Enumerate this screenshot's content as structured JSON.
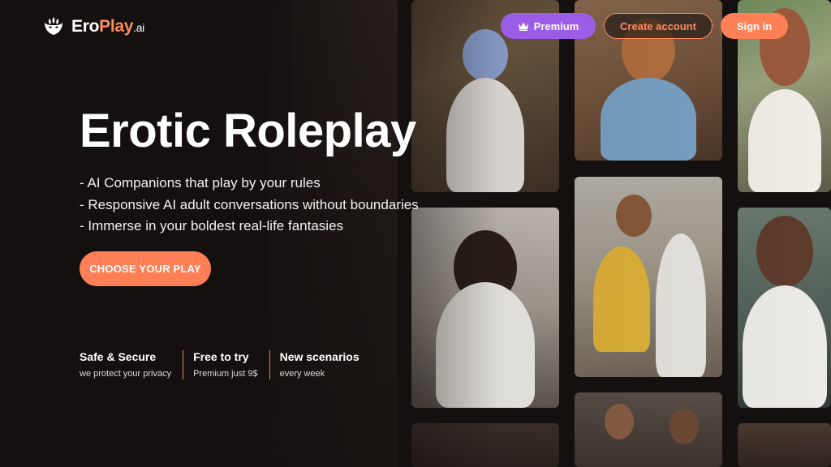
{
  "brand": {
    "name_part1": "Ero",
    "name_part2": "Play",
    "name_suffix": ".ai",
    "icon": "mask-icon",
    "accent": "#ff7f57",
    "premium_color": "#9b5de5"
  },
  "header": {
    "premium_label": "Premium",
    "premium_icon": "crown-icon",
    "create_account_label": "Create account",
    "sign_in_label": "Sign in"
  },
  "hero": {
    "title": "Erotic Roleplay",
    "bullets": [
      "- AI Companions that play by your rules",
      "- Responsive AI adult conversations without boundaries",
      "- Immerse in your boldest real-life fantasies"
    ],
    "cta_label": "CHOOSE YOUR PLAY"
  },
  "features": [
    {
      "title": "Safe & Secure",
      "subtitle": "we protect your privacy"
    },
    {
      "title": "Free to try",
      "subtitle": "Premium just 9$"
    },
    {
      "title": "New scenarios",
      "subtitle": "every week"
    }
  ]
}
